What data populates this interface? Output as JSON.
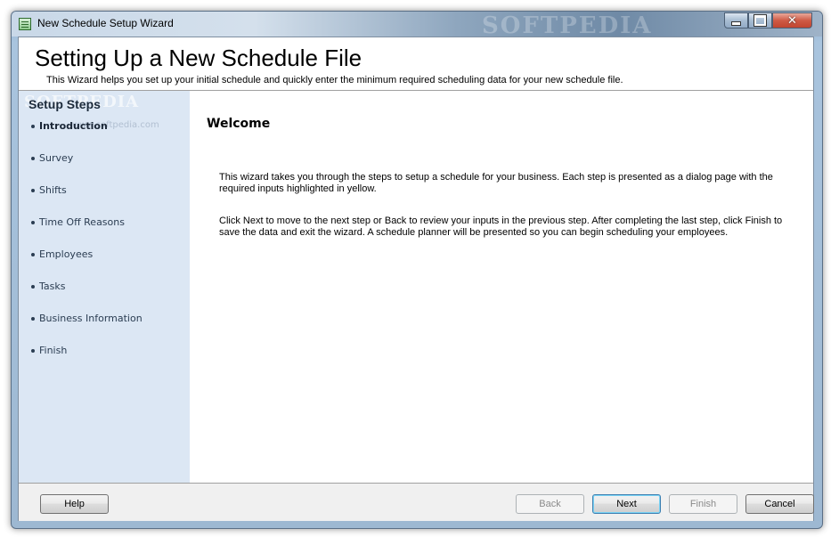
{
  "window": {
    "title": "New Schedule Setup Wizard",
    "watermark": "SOFTPEDIA",
    "controls": {
      "minimize": "minimize",
      "maximize": "maximize",
      "close": "✕"
    }
  },
  "header": {
    "title": "Setting Up a New Schedule File",
    "subtitle": "This Wizard helps you set up your initial schedule and quickly enter the minimum required scheduling data for your new schedule file."
  },
  "sidebar": {
    "title": "Setup Steps",
    "watermark": "SOFTPEDIA",
    "watermark_url": "www.softpedia.com",
    "steps": [
      {
        "label": "Introduction",
        "active": true
      },
      {
        "label": "Survey",
        "active": false
      },
      {
        "label": "Shifts",
        "active": false
      },
      {
        "label": "Time Off Reasons",
        "active": false
      },
      {
        "label": "Employees",
        "active": false
      },
      {
        "label": "Tasks",
        "active": false
      },
      {
        "label": "Business Information",
        "active": false
      },
      {
        "label": "Finish",
        "active": false
      }
    ]
  },
  "main": {
    "heading": "Welcome",
    "paragraph1": "This wizard takes you through the steps to setup a schedule for your business.   Each step is presented as a dialog page with the required inputs highlighted in yellow.",
    "paragraph2": "Click Next to move to the next step or Back to review your inputs in the previous step.   After completing the last step, click Finish to save the data and exit the wizard.  A schedule planner will be presented so you can begin scheduling your employees."
  },
  "footer": {
    "help": "Help",
    "back": "Back",
    "next": "Next",
    "finish": "Finish",
    "cancel": "Cancel"
  },
  "colors": {
    "sidebar_bg": "#dce7f4",
    "frame": "#9db8d2"
  }
}
